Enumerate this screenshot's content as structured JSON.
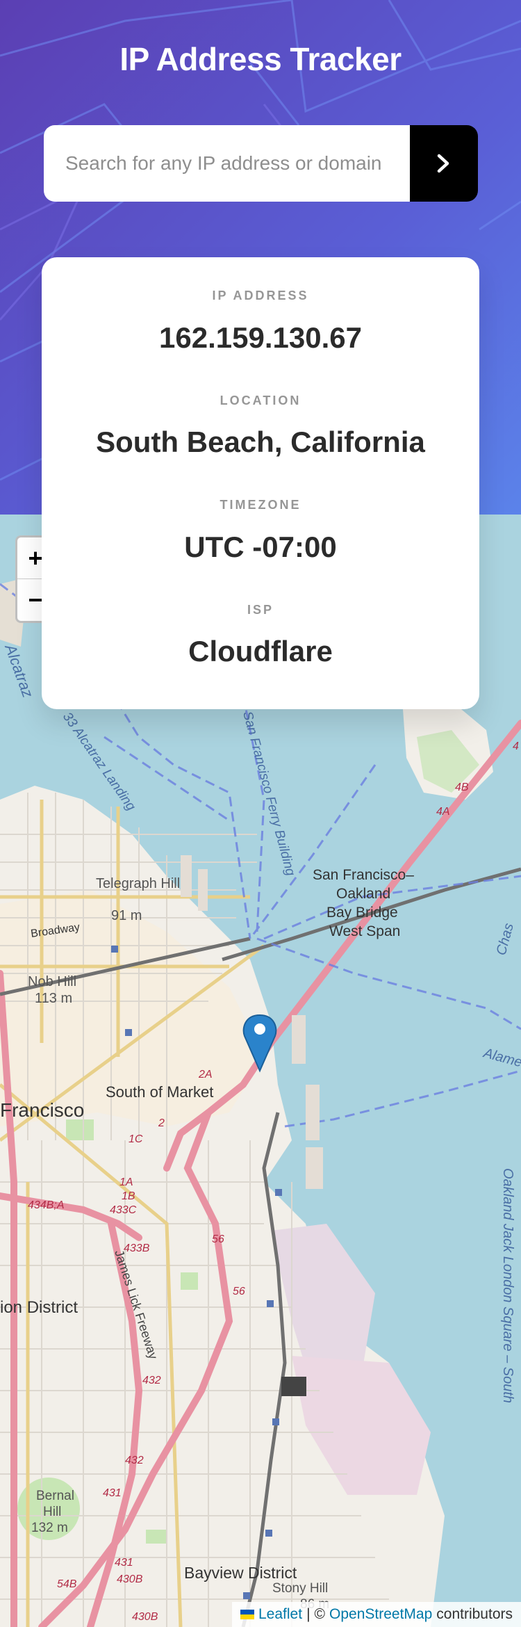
{
  "header": {
    "title": "IP Address Tracker",
    "search_placeholder": "Search for any IP address or domain",
    "submit_icon": "chevron-right-icon"
  },
  "info": {
    "ip_label": "IP ADDRESS",
    "ip_value": "162.159.130.67",
    "location_label": "LOCATION",
    "location_value": "South Beach, California",
    "timezone_label": "TIMEZONE",
    "timezone_value": "UTC -07:00",
    "isp_label": "ISP",
    "isp_value": "Cloudflare"
  },
  "map": {
    "zoom_in": "+",
    "zoom_out": "−",
    "labels": {
      "alcatraz": "Alcatraz",
      "alcatraz_landing": "33 Alcatraz Landing",
      "ferry": "San Francisco Ferry Building",
      "telegraph": "Telegraph Hill",
      "telegraph_elev": "91 m",
      "broadway": "Broadway",
      "nob_hill": "Nob Hill",
      "nob_elev": "113 m",
      "bay_bridge_1": "San Francisco–",
      "bay_bridge_2": "Oakland",
      "bay_bridge_3": "Bay Bridge",
      "bay_bridge_4": "West Span",
      "south_of_market": "South of Market",
      "francisco": "Francisco",
      "mission_district": "ion District",
      "james_lick": "James Lick Freeway",
      "bernal_1": "Bernal",
      "bernal_2": "Hill",
      "bernal_3": "132 m",
      "bayview": "Bayview District",
      "stony_1": "Stony Hill",
      "stony_2": "86 m",
      "oakland_jack": "Oakland Jack London Square – South",
      "alameda": "Alame",
      "chase": "Chas",
      "r4": "4",
      "r4a": "4A",
      "r4b": "4B",
      "r2a": "2A",
      "r2": "2",
      "r1c": "1C",
      "r1a": "1A",
      "r1b": "1B",
      "r433c": "433C",
      "r434b": "434B;A",
      "r433b": "433B",
      "r56a": "56",
      "r56b": "56",
      "r432a": "432",
      "r432b": "432",
      "r431a": "431",
      "r431b": "431",
      "r430b": "430B",
      "r54b": "54B",
      "r430b2": "430B"
    },
    "marker_icon": "location-pin-icon"
  },
  "attribution": {
    "leaflet": "Leaflet",
    "separator": "|",
    "copyright": "©",
    "osm": "OpenStreetMap",
    "contributors": "contributors"
  }
}
